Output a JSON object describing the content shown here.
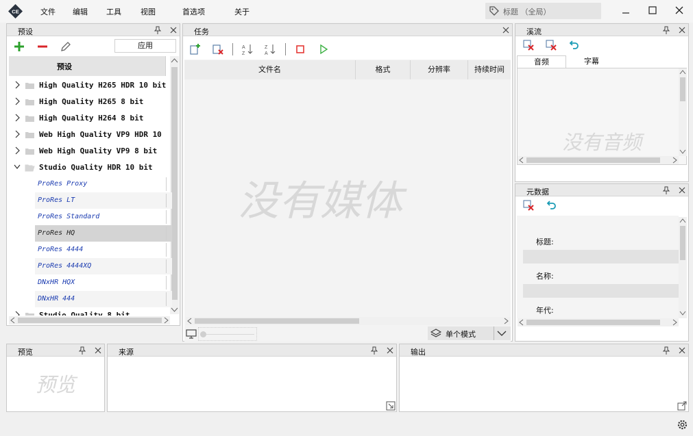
{
  "app": {
    "logo": "CE"
  },
  "menu": {
    "items": [
      "文件",
      "编辑",
      "工具",
      "视图",
      "首选项",
      "关于"
    ]
  },
  "search": {
    "placeholder": "标题  （全局）"
  },
  "presets": {
    "title": "预设",
    "apply_label": "应用",
    "column_header": "预设",
    "groups": [
      {
        "label": "High Quality H265 HDR 10 bit",
        "expanded": false
      },
      {
        "label": "High Quality H265 8 bit",
        "expanded": false
      },
      {
        "label": "High Quality H264 8 bit",
        "expanded": false
      },
      {
        "label": "Web High Quality VP9 HDR 10",
        "expanded": false
      },
      {
        "label": "Web High Quality VP9 8 bit",
        "expanded": false
      },
      {
        "label": "Studio Quality HDR 10 bit",
        "expanded": true
      },
      {
        "label": "Studio Quality 8 bit",
        "expanded": false
      }
    ],
    "leaves": [
      "ProRes Proxy",
      "ProRes LT",
      "ProRes Standard",
      "ProRes HQ",
      "ProRes 4444",
      "ProRes 4444XQ",
      "DNxHR HQX",
      "DNxHR 444"
    ],
    "selected_leaf": "ProRes HQ"
  },
  "tasks": {
    "title": "任务",
    "columns": [
      "文件名",
      "格式",
      "分辨率",
      "持续时间"
    ],
    "empty_text": "没有媒体",
    "mode_label": "单个模式"
  },
  "streams": {
    "title": "溪流",
    "tabs": [
      "音频",
      "字幕"
    ],
    "active_tab": "音频",
    "empty_text": "没有音频"
  },
  "metadata": {
    "title": "元数据",
    "fields": [
      "标题:",
      "名称:",
      "年代:"
    ]
  },
  "preview": {
    "title": "预览",
    "empty_text": "预览"
  },
  "source": {
    "title": "来源"
  },
  "output": {
    "title": "输出"
  },
  "colors": {
    "green_plus": "#2ca02c",
    "red_minus": "#d9262a",
    "red_stop": "#e53935",
    "green_play": "#3cb043",
    "teal_undo": "#1a9bb5"
  }
}
